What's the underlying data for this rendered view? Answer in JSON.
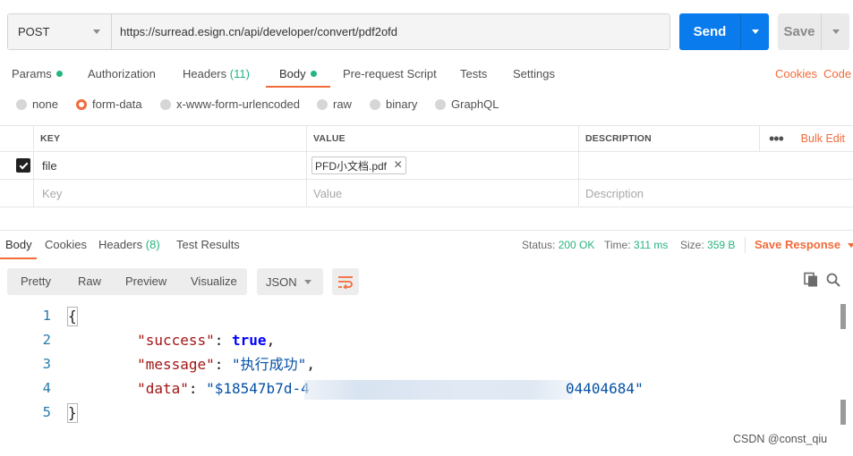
{
  "request": {
    "method": "POST",
    "url": "https://surread.esign.cn/api/developer/convert/pdf2ofd",
    "send_label": "Send",
    "save_label": "Save"
  },
  "request_tabs": [
    {
      "label": "Params",
      "dot": true
    },
    {
      "label": "Authorization"
    },
    {
      "label": "Headers",
      "count": "(11)"
    },
    {
      "label": "Body",
      "dot": true,
      "active": true
    },
    {
      "label": "Pre-request Script"
    },
    {
      "label": "Tests"
    },
    {
      "label": "Settings"
    }
  ],
  "right_links": {
    "cookies": "Cookies",
    "code": "Code"
  },
  "body_types": [
    {
      "label": "none",
      "selected": false
    },
    {
      "label": "form-data",
      "selected": true
    },
    {
      "label": "x-www-form-urlencoded",
      "selected": false
    },
    {
      "label": "raw",
      "selected": false
    },
    {
      "label": "binary",
      "selected": false
    },
    {
      "label": "GraphQL",
      "selected": false
    }
  ],
  "params_table": {
    "headers": {
      "key": "KEY",
      "value": "VALUE",
      "description": "DESCRIPTION"
    },
    "more_label": "•••",
    "bulk_edit": "Bulk Edit",
    "rows": [
      {
        "checked": true,
        "key": "file",
        "value_file": "PFD小文档.pdf",
        "description": ""
      }
    ],
    "placeholders": {
      "key": "Key",
      "value": "Value",
      "description": "Description"
    }
  },
  "response_tabs": [
    {
      "label": "Body",
      "active": true
    },
    {
      "label": "Cookies"
    },
    {
      "label": "Headers",
      "count": "(8)"
    },
    {
      "label": "Test Results"
    }
  ],
  "response_meta": {
    "status_label": "Status:",
    "status_value": "200 OK",
    "time_label": "Time:",
    "time_value": "311 ms",
    "size_label": "Size:",
    "size_value": "359 B",
    "save_response": "Save Response"
  },
  "view_modes": [
    "Pretty",
    "Raw",
    "Preview",
    "Visualize"
  ],
  "format": "JSON",
  "code": {
    "line_numbers": [
      "1",
      "2",
      "3",
      "4",
      "5"
    ],
    "open_brace": "{",
    "close_brace": "}",
    "success_key": "\"success\"",
    "success_value": "true",
    "message_key": "\"message\"",
    "message_value": "\"执行成功\"",
    "data_key": "\"data\"",
    "data_value_visible_start": "\"$18547b7d-4",
    "data_value_visible_end": "04404684\""
  },
  "watermark": "CSDN @const_qiu",
  "colors": {
    "accent": "#f26b3a",
    "send": "#097bed",
    "success": "#26b47f"
  },
  "icons": [
    "chevron-down-icon",
    "check-icon",
    "close-icon",
    "wrap-lines-icon",
    "copy-icon",
    "search-icon"
  ]
}
